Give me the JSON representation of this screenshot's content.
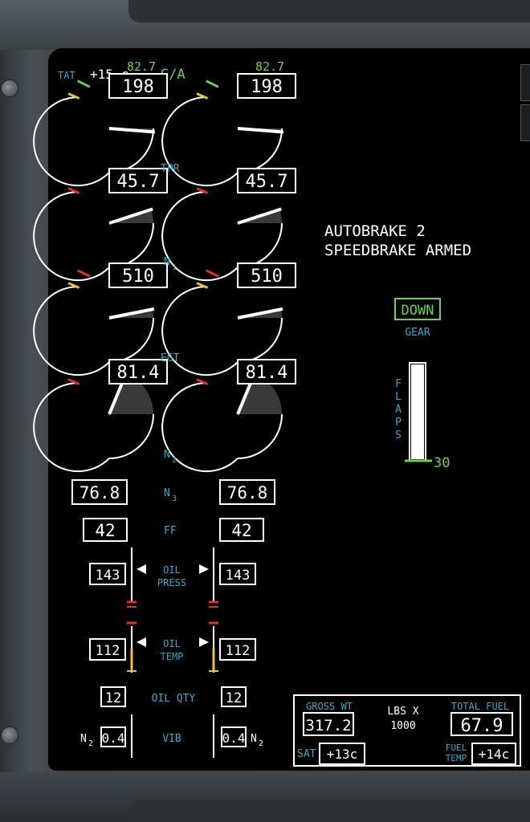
{
  "header": {
    "tat_label": "TAT",
    "tat_value": "+15 c",
    "mode": "G/A"
  },
  "engines": [
    {
      "tpr_ref": "82.7",
      "tpr": "198",
      "n1": "45.7",
      "egt": "510",
      "n2": "81.4",
      "n3": "76.8",
      "ff": "42",
      "oil_press": "143",
      "oil_temp": "112",
      "oil_qty": "12",
      "vib": "0.4",
      "gauge_values": {
        "tpr": 0.62,
        "n1": 0.52,
        "egt": 0.55,
        "n2": 0.3
      }
    },
    {
      "tpr_ref": "82.7",
      "tpr": "198",
      "n1": "45.7",
      "egt": "510",
      "n2": "81.4",
      "n3": "76.8",
      "ff": "42",
      "oil_press": "143",
      "oil_temp": "112",
      "oil_qty": "12",
      "vib": "0.4",
      "gauge_values": {
        "tpr": 0.62,
        "n1": 0.52,
        "egt": 0.55,
        "n2": 0.3
      }
    }
  ],
  "labels": {
    "tpr": "TPR",
    "n1": "N",
    "n1_sub": "1",
    "egt": "EGT",
    "n2": "N",
    "n2_sub": "2",
    "n3": "N",
    "n3_sub": "3",
    "ff": "FF",
    "oil_press_1": "OIL",
    "oil_press_2": "PRESS",
    "oil_temp_1": "OIL",
    "oil_temp_2": "TEMP",
    "oil_qty": "OIL QTY",
    "vib": "VIB",
    "vib_n": "N",
    "vib_sub": "2"
  },
  "messages": {
    "line1": "AUTOBRAKE 2",
    "line2": "SPEEDBRAKE ARMED"
  },
  "gear": {
    "status": "DOWN",
    "label": "GEAR"
  },
  "flaps": {
    "label": "FLAPS",
    "value": "30",
    "fraction": 1.0
  },
  "weights": {
    "gross_label": "GROSS WT",
    "gross_value": "317.2",
    "units_1": "LBS X",
    "units_2": "1000",
    "fuel_label": "TOTAL FUEL",
    "fuel_value": "67.9",
    "sat_label": "SAT",
    "sat_value": "+13c",
    "fuel_temp_1": "FUEL",
    "fuel_temp_2": "TEMP",
    "fuel_temp_value": "+14c"
  },
  "colors": {
    "cyan": "#3aa8c8",
    "green": "#6fcf4a",
    "white": "#ffffff",
    "amber": "#e8c23a",
    "red": "#e23030",
    "magenta": "#d23a7a"
  }
}
